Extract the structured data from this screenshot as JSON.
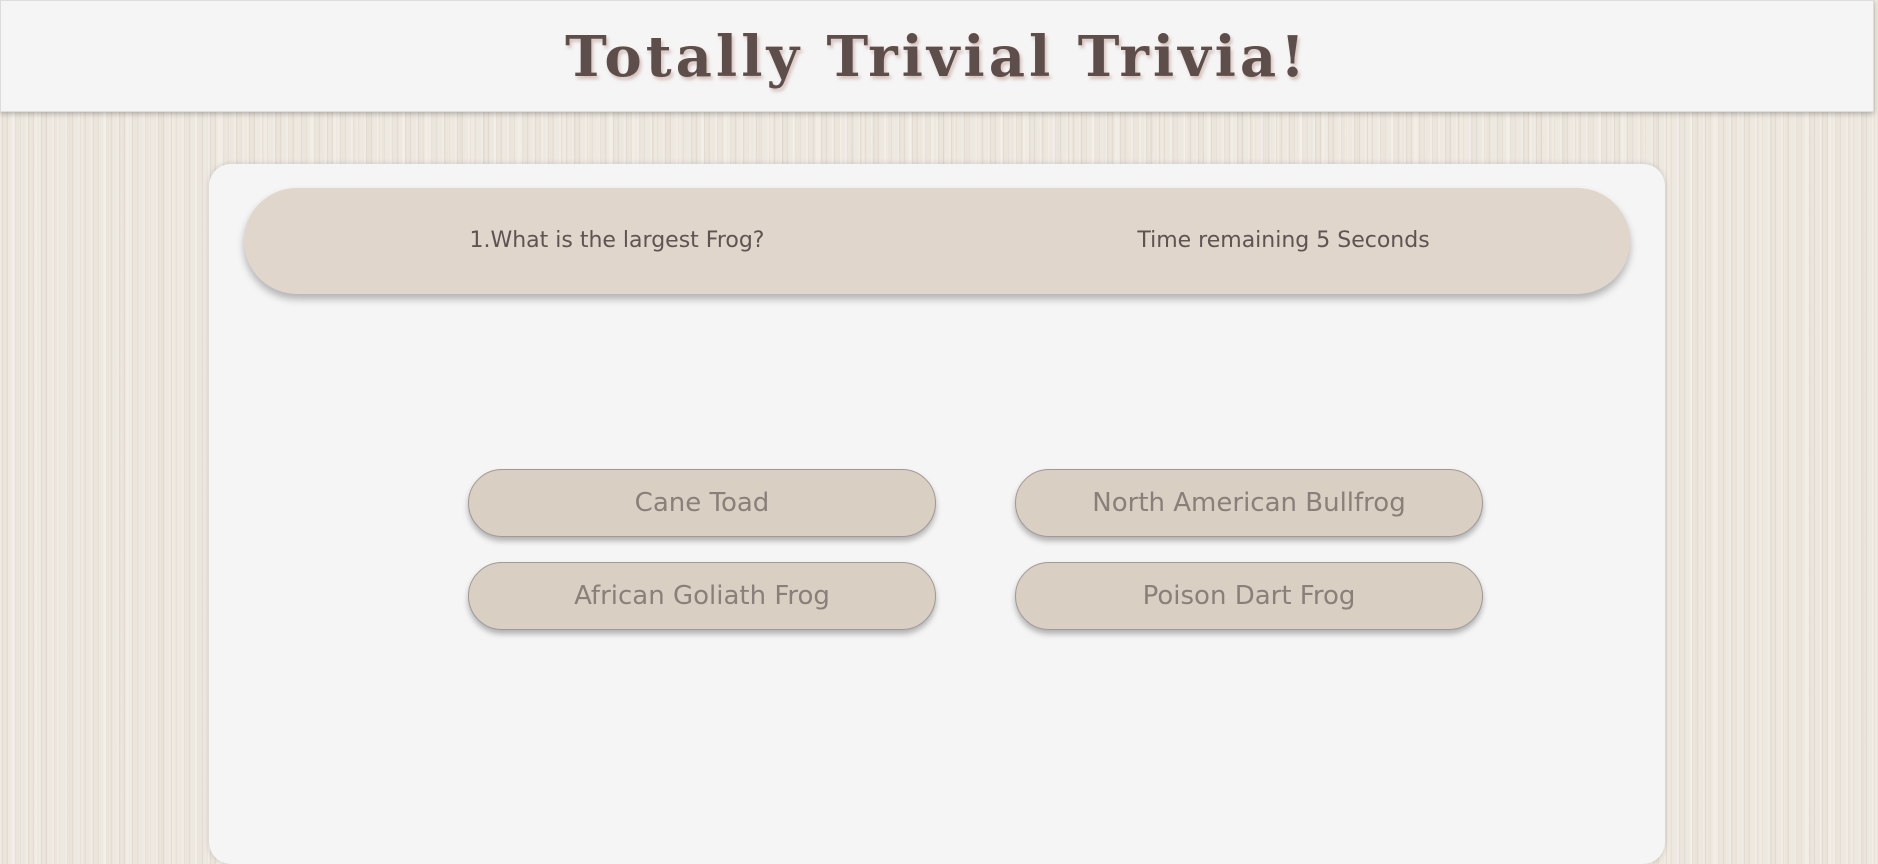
{
  "header": {
    "title": "Totally Trivial Trivia!"
  },
  "quiz": {
    "question": "1.What is the largest Frog?",
    "timer": "Time remaining 5 Seconds",
    "answers": [
      "Cane Toad",
      "North American Bullfrog",
      "African Goliath Frog",
      "Poison Dart Frog"
    ]
  },
  "colors": {
    "title": "#5e4e4b",
    "bar": "#e0d6cc",
    "button": "#d9cfc3",
    "card": "#f5f5f5"
  }
}
